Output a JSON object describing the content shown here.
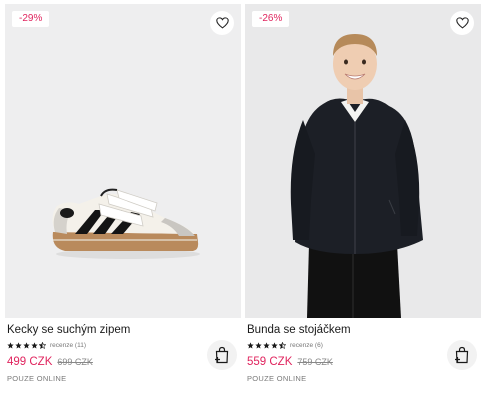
{
  "products": [
    {
      "badge": "-29%",
      "title": "Kecky se suchým zipem",
      "reviews": "recenze (11)",
      "price": "499 CZK",
      "old_price": "699 CZK",
      "availability": "POUZE ONLINE",
      "rating": 4.5,
      "image": "white-velcro-sneaker"
    },
    {
      "badge": "-26%",
      "title": "Bunda se stojáčkem",
      "reviews": "recenze (6)",
      "price": "559 CZK",
      "old_price": "759 CZK",
      "availability": "POUZE ONLINE",
      "rating": 4.5,
      "image": "boy-in-black-jacket"
    }
  ],
  "colors": {
    "accent": "#e0245e",
    "muted": "#7a7a7a"
  },
  "icons": {
    "wishlist": "heart-icon",
    "cart": "add-to-bag-icon",
    "star": "star-icon"
  }
}
